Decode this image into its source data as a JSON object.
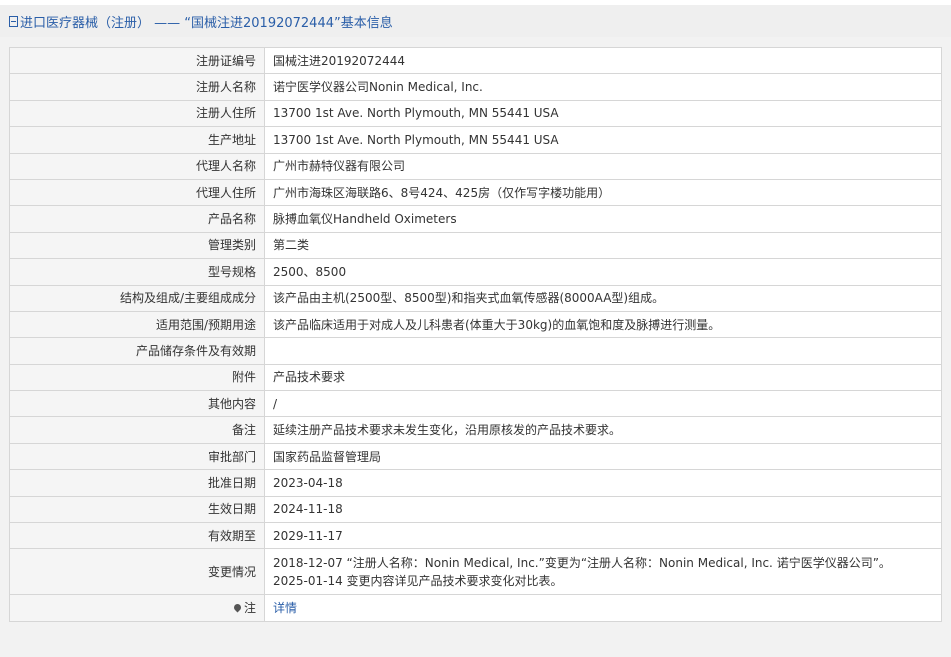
{
  "header": {
    "title": "进口医疗器械（注册） —— “国械注进20192072444”基本信息"
  },
  "rows": [
    {
      "label": "注册证编号",
      "value": "国械注进20192072444"
    },
    {
      "label": "注册人名称",
      "value": "诺宁医学仪器公司Nonin Medical, Inc."
    },
    {
      "label": "注册人住所",
      "value": "13700 1st Ave. North Plymouth, MN 55441 USA"
    },
    {
      "label": "生产地址",
      "value": "13700 1st Ave. North Plymouth, MN 55441 USA"
    },
    {
      "label": "代理人名称",
      "value": "广州市赫特仪器有限公司"
    },
    {
      "label": "代理人住所",
      "value": "广州市海珠区海联路6、8号424、425房（仅作写字楼功能用）"
    },
    {
      "label": "产品名称",
      "value": "脉搏血氧仪Handheld Oximeters"
    },
    {
      "label": "管理类别",
      "value": "第二类"
    },
    {
      "label": "型号规格",
      "value": "2500、8500"
    },
    {
      "label": "结构及组成/主要组成成分",
      "value": "该产品由主机(2500型、8500型)和指夹式血氧传感器(8000AA型)组成。"
    },
    {
      "label": "适用范围/预期用途",
      "value": "该产品临床适用于对成人及儿科患者(体重大于30kg)的血氧饱和度及脉搏进行测量。"
    },
    {
      "label": "产品储存条件及有效期",
      "value": ""
    },
    {
      "label": "附件",
      "value": "产品技术要求"
    },
    {
      "label": "其他内容",
      "value": "/"
    },
    {
      "label": "备注",
      "value": "延续注册产品技术要求未发生变化，沿用原核发的产品技术要求。"
    },
    {
      "label": "审批部门",
      "value": "国家药品监督管理局"
    },
    {
      "label": "批准日期",
      "value": "2023-04-18"
    },
    {
      "label": "生效日期",
      "value": "2024-11-18"
    },
    {
      "label": "有效期至",
      "value": "2029-11-17"
    }
  ],
  "changes": {
    "label": "变更情况",
    "line1": "2018-12-07 “注册人名称：Nonin Medical, Inc.”变更为“注册人名称：Nonin Medical, Inc. 诺宁医学仪器公司”。",
    "line2": "2025-01-14 变更内容详见产品技术要求变化对比表。"
  },
  "note": {
    "label": "注",
    "link": "详情"
  }
}
